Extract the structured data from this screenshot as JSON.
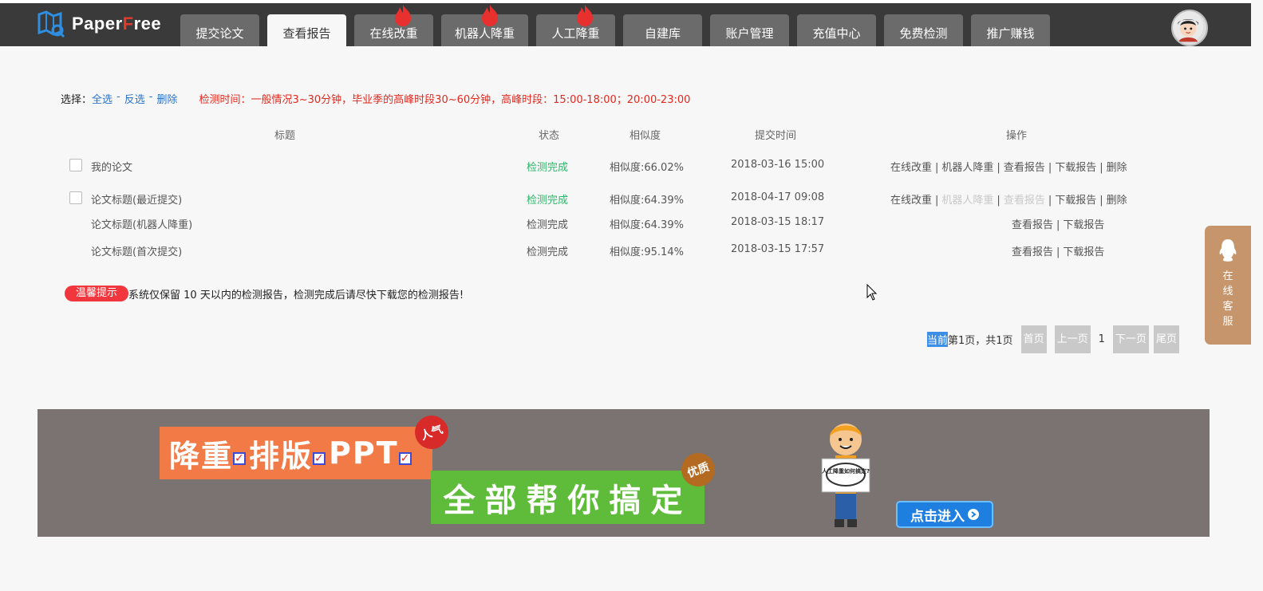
{
  "brand": {
    "logo_part1": "Paper",
    "logo_f": "F",
    "logo_part2": "ree"
  },
  "nav": {
    "tabs": [
      {
        "label": "提交论文",
        "hot": false
      },
      {
        "label": "查看报告",
        "hot": false,
        "active": true
      },
      {
        "label": "在线改重",
        "hot": true
      },
      {
        "label": "机器人降重",
        "hot": true
      },
      {
        "label": "人工降重",
        "hot": true
      },
      {
        "label": "自建库",
        "hot": false
      },
      {
        "label": "账户管理",
        "hot": false
      },
      {
        "label": "充值中心",
        "hot": false
      },
      {
        "label": "免费检测",
        "hot": false
      },
      {
        "label": "推广赚钱",
        "hot": false
      }
    ]
  },
  "toolbar": {
    "select_label": "选择：",
    "select_all": "全选",
    "invert": "反选",
    "delete": "删除",
    "notice": "检测时间：一般情况3~30分钟，毕业季的高峰时段30~60分钟，高峰时段：15:00-18:00；20:00-23:00"
  },
  "table": {
    "headers": {
      "title": "标题",
      "status": "状态",
      "similarity": "相似度",
      "time": "提交时间",
      "ops": "操作"
    },
    "rows": [
      {
        "title": "我的论文",
        "status": "检测完成",
        "similarity": "相似度:66.02%",
        "time": "2018-03-16 15:00",
        "ops": [
          "在线改重",
          "机器人降重",
          "查看报告",
          "下载报告",
          "删除"
        ]
      },
      {
        "title": "论文标题(最近提交)",
        "status": "检测完成",
        "similarity": "相似度:64.39%",
        "time": "2018-04-17 09:08",
        "ops": [
          "在线改重",
          "机器人降重",
          "查看报告",
          "下载报告",
          "删除"
        ]
      },
      {
        "title": "论文标题(机器人降重)",
        "status": "检测完成",
        "similarity": "相似度:64.39%",
        "time": "2018-03-15 18:17",
        "ops": [
          "查看报告",
          "下载报告"
        ]
      },
      {
        "title": "论文标题(首次提交)",
        "status": "检测完成",
        "similarity": "相似度:95.14%",
        "time": "2018-03-15 17:57",
        "ops": [
          "查看报告",
          "下载报告"
        ]
      }
    ]
  },
  "tip": {
    "badge": "温馨提示",
    "text": "系统仅保留 10 天以内的检测报告，检测完成后请尽快下载您的检测报告!"
  },
  "pager": {
    "current_hl": "当前",
    "summary": "第1页，共1页",
    "first": "首页",
    "prev": "上一页",
    "page": "1",
    "next": "下一页",
    "last": "尾页"
  },
  "side_chat": {
    "label": "在线客服"
  },
  "banner": {
    "line1_words": [
      "降重",
      "排版",
      "PPT"
    ],
    "line2": "全部帮你搞定",
    "seal1": "人气",
    "seal2": "优质",
    "sign": "人工降重如何搞定?",
    "cta": "点击进入"
  },
  "colors": {
    "topbar": "#3a3a3a",
    "tab": "#6b6b6b",
    "link": "#2a73c9",
    "notice": "#e3281e",
    "green": "#2db669",
    "tip": "#f1363d",
    "side": "#c7956b",
    "banner": "#7b7371"
  }
}
